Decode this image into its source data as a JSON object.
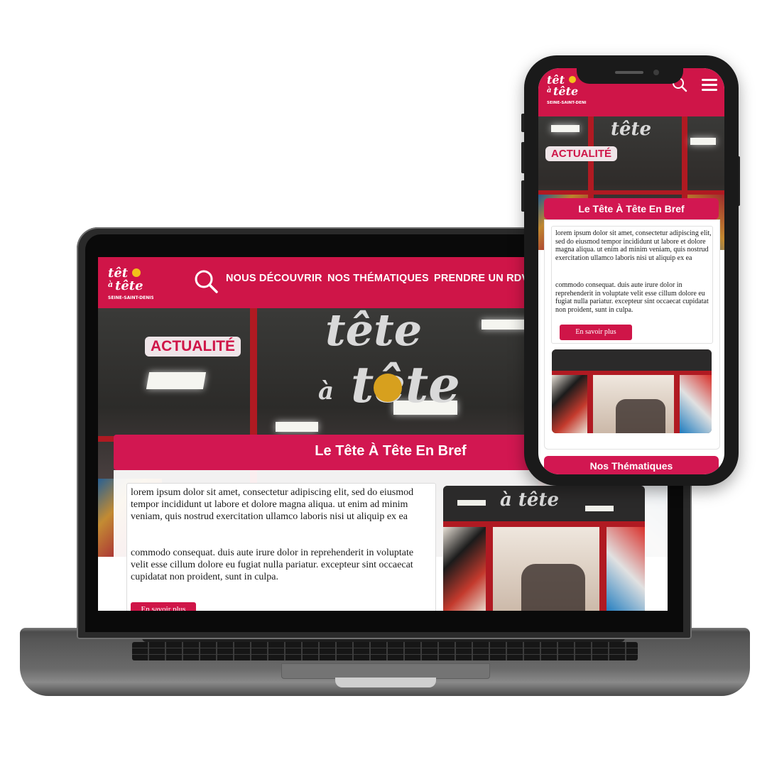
{
  "laptop": {
    "header": {
      "logo_alt": "tête à tête Seine-Saint-Denis",
      "nav": [
        "NOUS DÉCOUVRIR",
        "NOS THÉMATIQUES",
        "PRENDRE UN RDV"
      ]
    },
    "hero": {
      "badge": "ACTUALITÉ"
    },
    "section": {
      "title": "Le Tête À Tête En Bref",
      "paragraph_1": "lorem ipsum dolor sit amet, consectetur adipiscing elit, sed do eiusmod tempor incididunt ut labore et dolore magna aliqua. ut enim ad minim veniam, quis nostrud exercitation ullamco laboris nisi ut aliquip ex ea",
      "paragraph_2": "commodo consequat. duis aute irure dolor in reprehenderit in voluptate velit esse cillum dolore eu fugiat nulla pariatur. excepteur sint occaecat cupidatat non proident, sunt in culpa.",
      "button": "En savoir plus"
    }
  },
  "phone": {
    "hero": {
      "badge": "ACTUALITÉ"
    },
    "section": {
      "title": "Le Tête À Tête En Bref",
      "paragraph_1": "lorem ipsum dolor sit amet, consectetur adipiscing elit, sed do eiusmod tempor incididunt ut labore et dolore magna aliqua. ut enim ad minim veniam, quis nostrud exercitation ullamco laboris nisi ut aliquip ex ea",
      "paragraph_2": "commodo consequat. duis aute irure dolor in reprehenderit in voluptate velit esse cillum dolore eu fugiat nulla pariatur. excepteur sint occaecat cupidatat non proident, sunt in culpa.",
      "button": "En savoir plus"
    },
    "next_section": {
      "title": "Nos Thématiques"
    }
  },
  "icons": {
    "search": "search-icon",
    "menu": "hamburger-menu-icon"
  },
  "colors": {
    "brand": "#cf1548",
    "badge_bg": "#efe5e8",
    "logo_yellow": "#f2c21a"
  }
}
